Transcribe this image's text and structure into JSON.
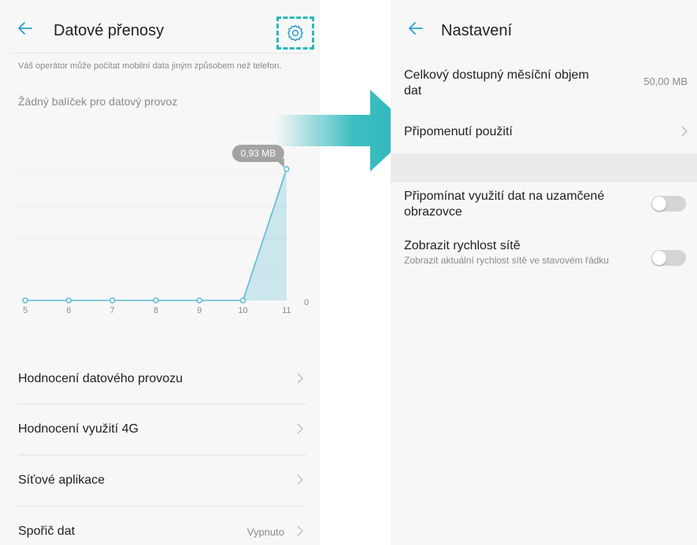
{
  "left_screen": {
    "title": "Datové přenosy",
    "operator_note": "Váš operátor může počítat mobilní data jiným způsobem než telefon.",
    "no_package": "Žádný balíček pro datový provoz",
    "chart_data": {
      "type": "area",
      "x": [
        "5",
        "6",
        "7",
        "8",
        "9",
        "10",
        "11"
      ],
      "values": [
        0,
        0,
        0,
        0,
        0,
        0,
        0.93
      ],
      "value_label": "0,93 MB",
      "y_tick": "0",
      "accent_color": "#5bbad4"
    },
    "items": [
      {
        "label": "Hodnocení datového provozu"
      },
      {
        "label": "Hodnocení využití 4G"
      },
      {
        "label": "Síťové aplikace"
      },
      {
        "label": "Spořič dat",
        "value": "Vypnuto"
      }
    ]
  },
  "right_screen": {
    "title": "Nastavení",
    "monthly_label": "Celkový dostupný měsíční objem dat",
    "monthly_value": "50,00 MB",
    "reminder_label": "Připomenutí použití",
    "lockscreen_label": "Připomínat využití dat na uzamčené obrazovce",
    "speed_label": "Zobrazit rychlost sítě",
    "speed_sublabel": "Zobrazit aktuální rychlost sítě ve stavovém řádku"
  },
  "colors": {
    "highlight": "#2ab7bb",
    "arrow": "#2ab7bb"
  },
  "icons": [
    "back-arrow-icon",
    "gear-icon",
    "chevron-right-icon"
  ]
}
